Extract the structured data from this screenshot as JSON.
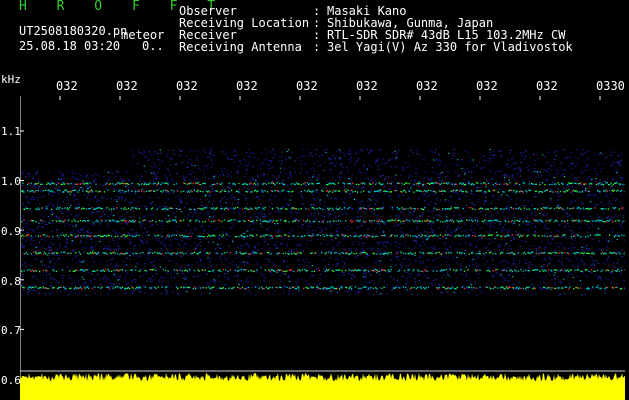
{
  "header": {
    "title": "H R O F F T",
    "filename": "UT2508180320.pn",
    "meteor_label": "meteor",
    "datetime": "25.08.18 03:20",
    "count": "0..",
    "fields": [
      {
        "label": "Observer",
        "value": "Masaki Kano"
      },
      {
        "label": "Receiving Location",
        "value": "Shibukawa, Gunma, Japan"
      },
      {
        "label": "Receiver",
        "value": "RTL-SDR SDR# 43dB L15 103.2MHz CW"
      },
      {
        "label": "Receiving Antenna",
        "value": "3el Yagi(V) Az 330 for Vladivostok"
      }
    ]
  },
  "axes": {
    "y_unit": "kHz",
    "x_ticks": [
      "032",
      "032",
      "032",
      "032",
      "032",
      "032",
      "032",
      "032",
      "032",
      "0330"
    ],
    "y_ticks": [
      "1.1",
      "1.0",
      "0.9",
      "0.8",
      "0.7",
      "0.6"
    ]
  },
  "colors": {
    "background": "#000000",
    "title": "#33cc33",
    "text": "#ffffff",
    "noise_floor": "#1a1aa0",
    "signal_low": "#00cccc",
    "signal_mid": "#33ff33",
    "signal_high": "#ff3333",
    "power_trace": "#ffff00"
  },
  "spectrogram": {
    "freq_range_khz": [
      0.6,
      1.15
    ],
    "signal_band_khz": [
      0.77,
      1.02
    ],
    "traces_khz": [
      0.995,
      0.98,
      0.945,
      0.92,
      0.89,
      0.855,
      0.82,
      0.785
    ]
  }
}
